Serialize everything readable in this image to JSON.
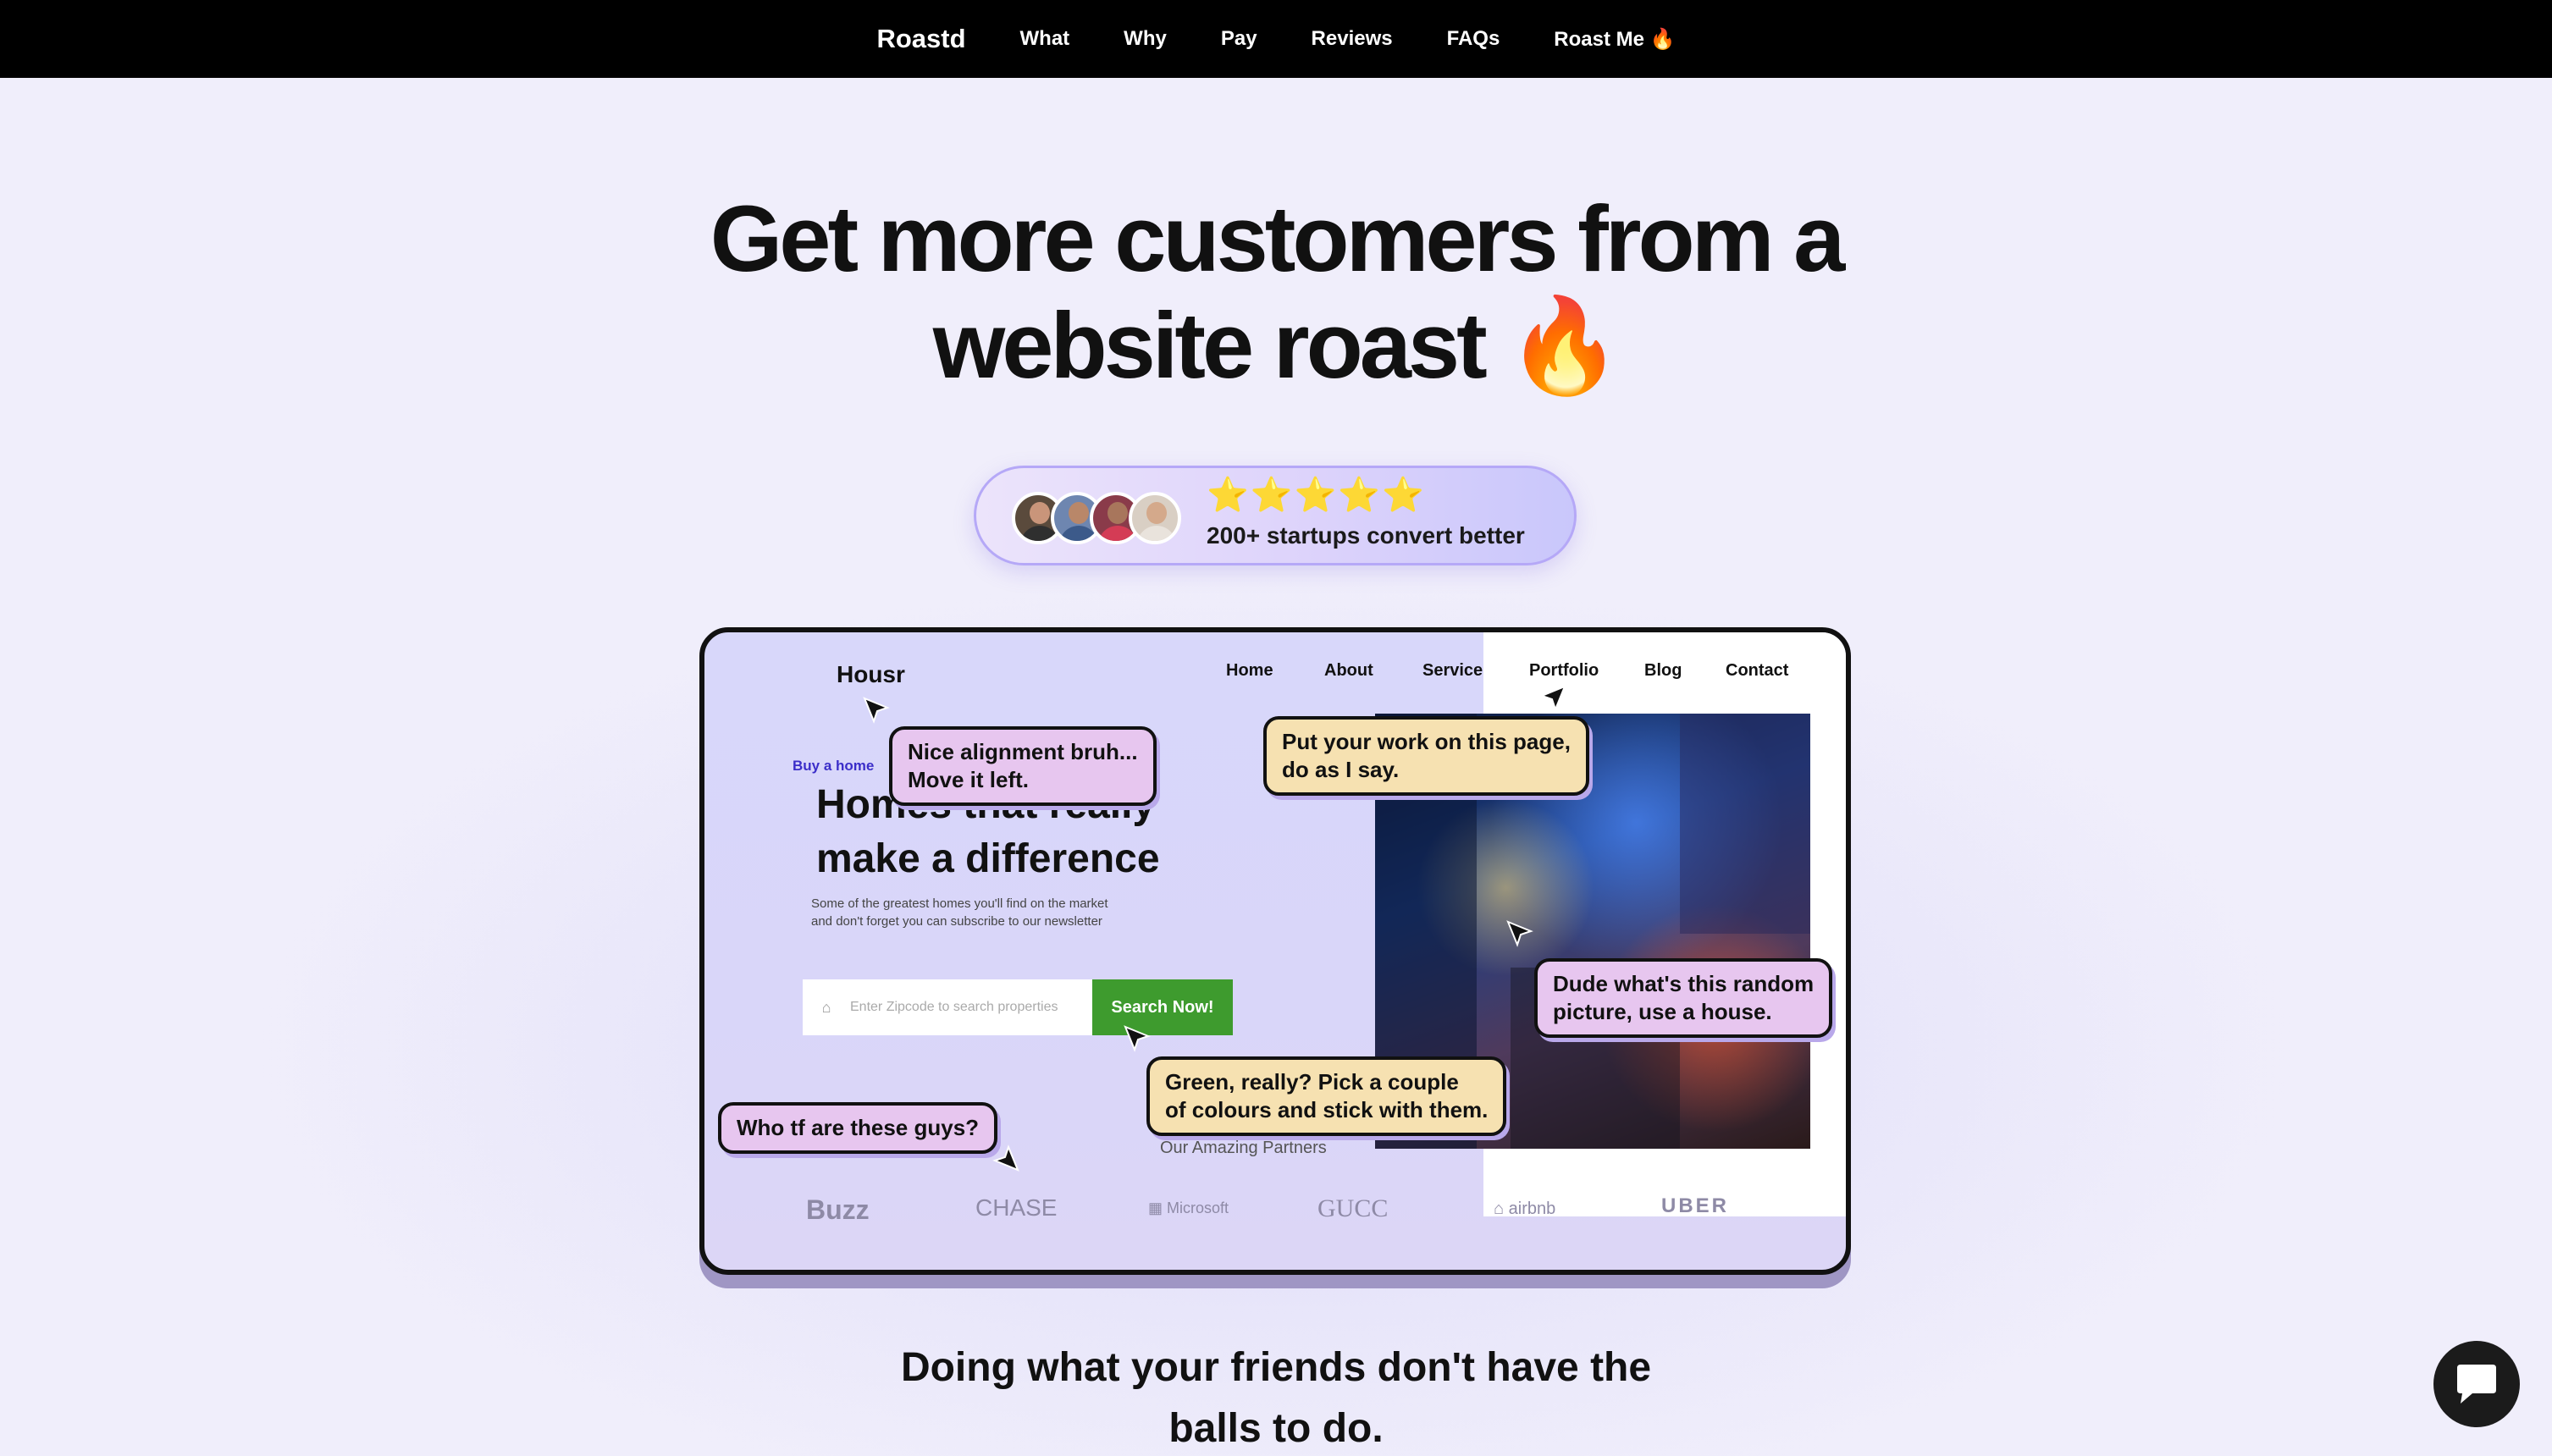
{
  "nav": {
    "brand": "Roastd",
    "links": [
      "What",
      "Why",
      "Pay",
      "Reviews",
      "FAQs",
      "Roast Me 🔥"
    ]
  },
  "hero": {
    "title_line1": "Get more customers from a",
    "title_line2": "website roast 🔥"
  },
  "badge": {
    "stars": "⭐⭐⭐⭐⭐",
    "text": "200+ startups convert better"
  },
  "mockup": {
    "logo": "Housr",
    "nav": [
      "Home",
      "About",
      "Service",
      "Portfolio",
      "Blog",
      "Contact"
    ],
    "kicker": "Buy a home",
    "headline_line1": "Homes that really",
    "headline_line2": "make a difference",
    "subtext": "Some of the greatest homes you'll find on the market and don't forget you can subscribe to our newsletter",
    "search_placeholder": "Enter Zipcode to search properties",
    "search_button": "Search Now!",
    "partners_label": "Our Amazing Partners",
    "partner_logos": [
      "Buzz",
      "CHASE",
      "Microsoft",
      "GUCC",
      "airbnb",
      "UBER"
    ]
  },
  "roast_bubbles": {
    "alignment_line1": "Nice alignment bruh...",
    "alignment_line2": "Move it left.",
    "portfolio_line1": "Put your work on this page,",
    "portfolio_line2": "do as I say.",
    "picture_line1": "Dude what's this random",
    "picture_line2": "picture, use a house.",
    "green_line1": "Green, really? Pick a couple",
    "green_line2": "of colours and stick with them.",
    "partners": "Who tf are these guys?"
  },
  "bottom": {
    "line1": "Doing what your friends don't have the",
    "line2": "balls to do."
  },
  "colors": {
    "nav_bg": "#000000",
    "badge_border": "#b5a8f7",
    "bubble_pink": "#e7c6ef",
    "bubble_yellow": "#f6e1b1",
    "search_button": "#3e9b2e",
    "kicker": "#3b2ec9"
  },
  "icons": {
    "chat": "chat-bubble-icon",
    "cursor": "mouse-pointer-icon",
    "search_field": "home-icon"
  }
}
